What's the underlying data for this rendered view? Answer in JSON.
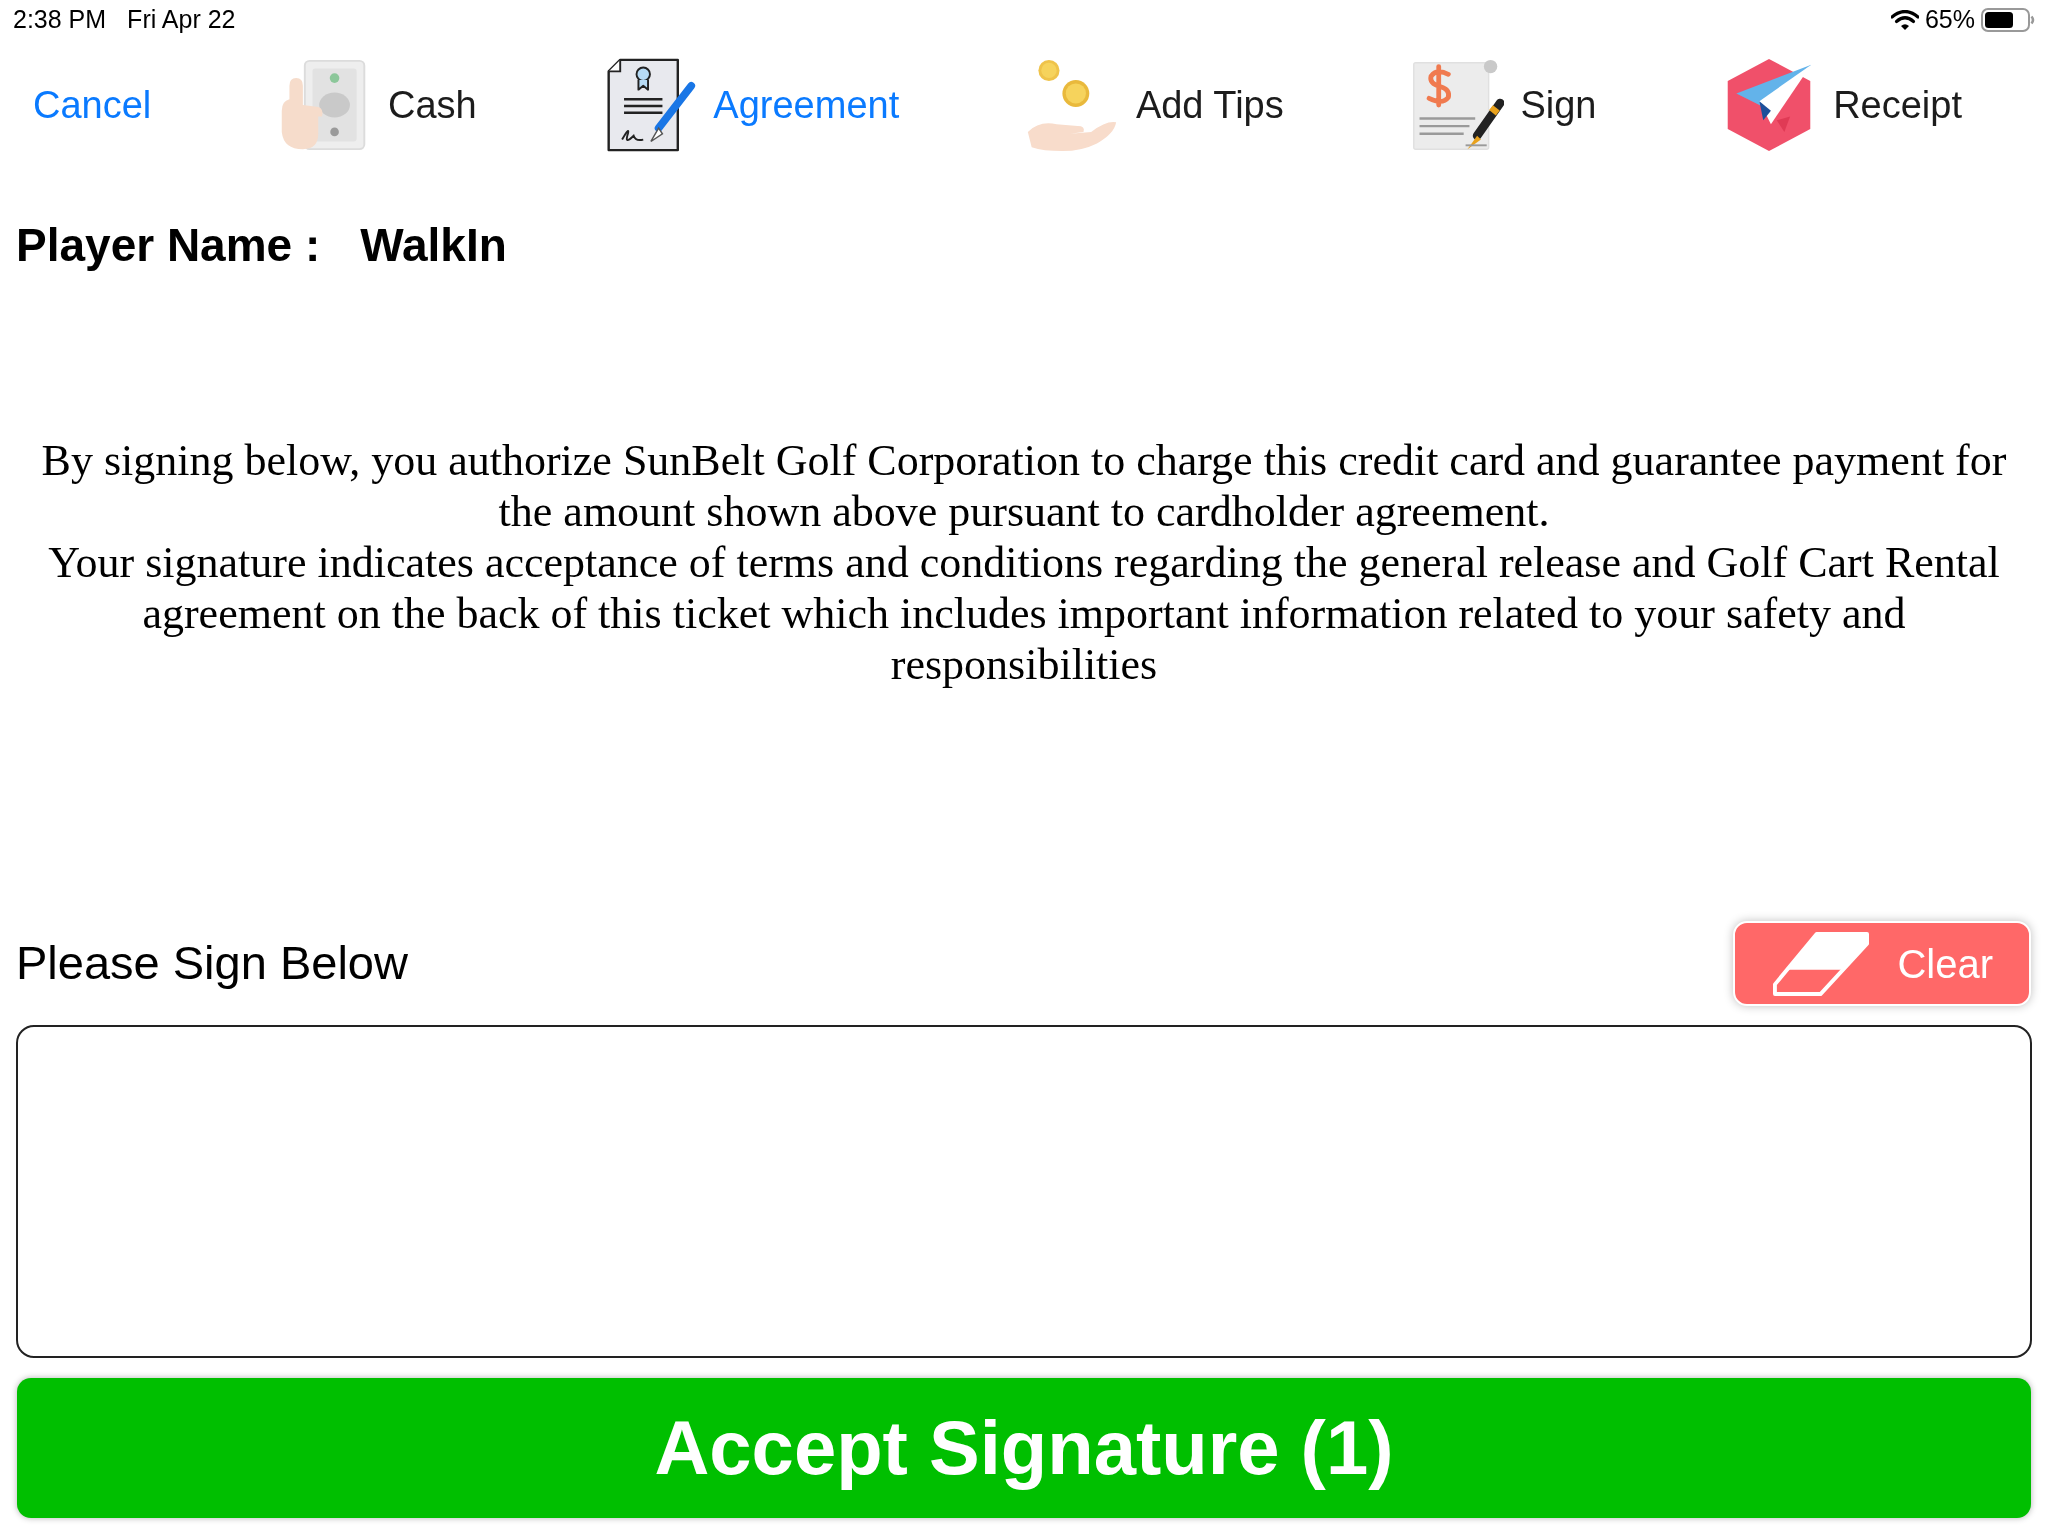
{
  "status_bar": {
    "time": "2:38 PM",
    "date": "Fri Apr 22",
    "battery": "65%"
  },
  "toolbar": {
    "cancel": {
      "label": "Cancel"
    },
    "steps": [
      {
        "label": "Cash",
        "selected": false
      },
      {
        "label": "Agreement",
        "selected": true
      },
      {
        "label": "Add Tips",
        "selected": false
      },
      {
        "label": "Sign",
        "selected": false
      },
      {
        "label": "Receipt",
        "selected": false
      }
    ]
  },
  "player": {
    "label": "Player Name :",
    "value": "WalkIn"
  },
  "agreement": {
    "paragraphs": [
      "By signing below, you authorize SunBelt Golf Corporation to charge this credit card and guarantee payment for the amount shown above pursuant to cardholder agreement.",
      "Your signature indicates acceptance of terms and conditions regarding the general release and Golf Cart Rental agreement on the back of this ticket which includes important information related to your safety and responsibilities"
    ]
  },
  "signature": {
    "label": "Please Sign Below",
    "clear_button": "Clear"
  },
  "accept_button": {
    "label": "Accept Signature (1)"
  }
}
